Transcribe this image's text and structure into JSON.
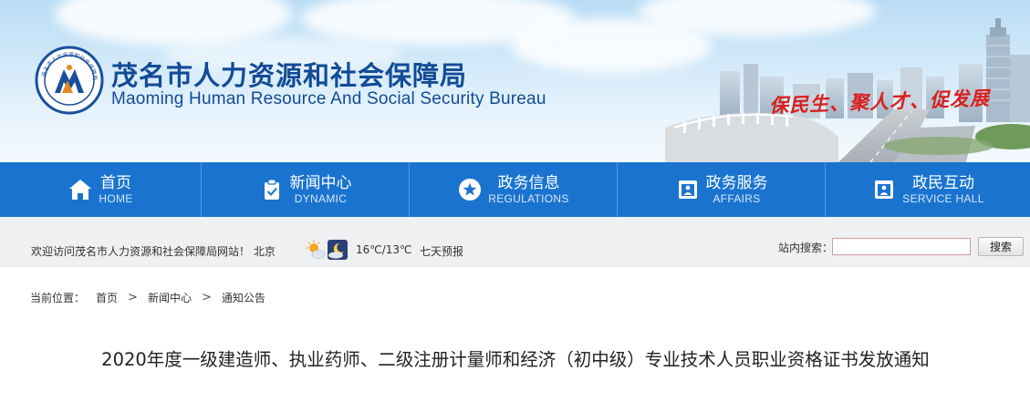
{
  "header": {
    "title": "茂名市人力资源和社会保障局",
    "subtitle": "Maoming Human Resource And Social Security Bureau",
    "slogan": "保民生、聚人才、促发展",
    "logo_text": "茂名市人力资源和社会保障局"
  },
  "nav": {
    "items": [
      {
        "label": "首页",
        "sublabel": "HOME",
        "icon": "home-icon"
      },
      {
        "label": "新闻中心",
        "sublabel": "DYNAMIC",
        "icon": "clipboard-check-icon"
      },
      {
        "label": "政务信息",
        "sublabel": "REGULATIONS",
        "icon": "star-circle-icon"
      },
      {
        "label": "政务服务",
        "sublabel": "AFFAIRS",
        "icon": "service-window-icon"
      },
      {
        "label": "政民互动",
        "sublabel": "SERVICE HALL",
        "icon": "service-window-icon"
      }
    ],
    "colors": {
      "background": "#1a74cf",
      "divider": "#4f96df"
    }
  },
  "infobar": {
    "welcome": "欢迎访问茂名市人力资源和社会保障局网站！ 北京",
    "weather_icons": [
      "sun-cloud-icon",
      "moon-cloud-icon"
    ],
    "temperature": "16℃/13℃",
    "forecast_link": "七天预报",
    "search_label": "站内搜索：",
    "search_value": "",
    "search_button": "搜索"
  },
  "breadcrumb": {
    "prefix": "当前位置：",
    "items": [
      "首页",
      "新闻中心",
      "通知公告"
    ],
    "separator": ">"
  },
  "article": {
    "title": "2020年度一级建造师、执业药师、二级注册计量师和经济（初中级）专业技术人员职业资格证书发放通知"
  }
}
